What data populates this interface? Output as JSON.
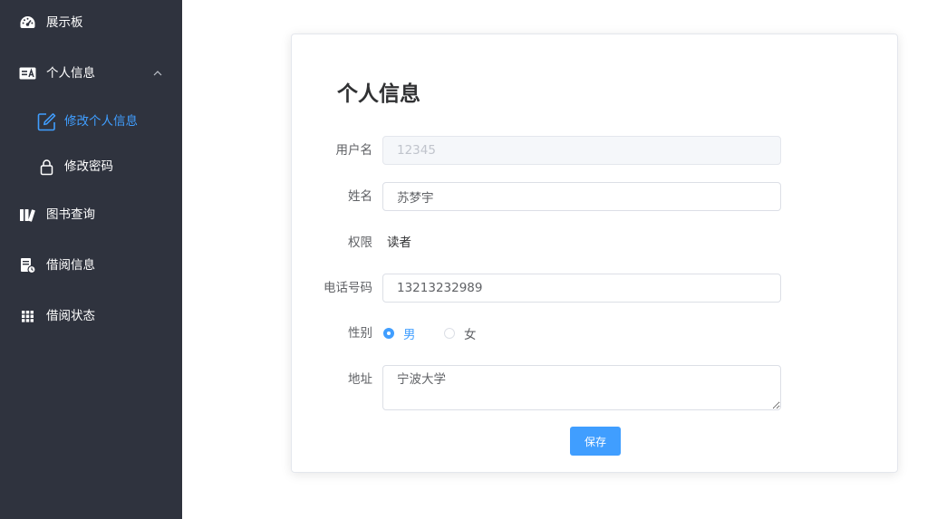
{
  "sidebar": {
    "items": [
      {
        "label": "展示板",
        "icon": "dashboard-icon"
      },
      {
        "label": "个人信息",
        "icon": "id-card-icon",
        "expanded": true,
        "children": [
          {
            "label": "修改个人信息",
            "icon": "edit-icon",
            "active": true
          },
          {
            "label": "修改密码",
            "icon": "lock-icon"
          }
        ]
      },
      {
        "label": "图书查询",
        "icon": "books-icon"
      },
      {
        "label": "借阅信息",
        "icon": "document-clock-icon"
      },
      {
        "label": "借阅状态",
        "icon": "grid-icon"
      }
    ]
  },
  "form": {
    "title": "个人信息",
    "username_label": "用户名",
    "username_value": "12345",
    "name_label": "姓名",
    "name_value": "苏梦宇",
    "role_label": "权限",
    "role_value": "读者",
    "phone_label": "电话号码",
    "phone_value": "13213232989",
    "gender_label": "性别",
    "gender_options": [
      "男",
      "女"
    ],
    "gender_selected": "男",
    "address_label": "地址",
    "address_value": "宁波大学",
    "save_label": "保存"
  },
  "colors": {
    "sidebar_bg": "#2f333e",
    "accent": "#409eff"
  }
}
